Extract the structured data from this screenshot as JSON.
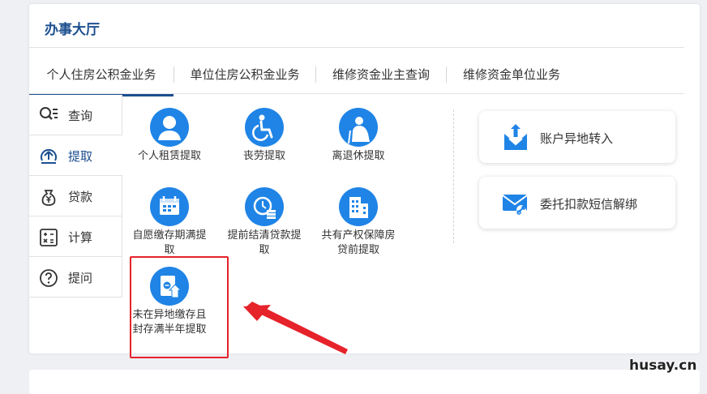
{
  "hall": {
    "title": "办事大厅"
  },
  "tabs": [
    {
      "label": "个人住房公积金业务",
      "active": true
    },
    {
      "label": "单位住房公积金业务",
      "active": false
    },
    {
      "label": "维修资金业主查询",
      "active": false
    },
    {
      "label": "维修资金单位业务",
      "active": false
    }
  ],
  "sidebar": {
    "items": [
      {
        "label": "查询",
        "icon": "search-list-icon"
      },
      {
        "label": "提取",
        "icon": "withdraw-icon",
        "active": true
      },
      {
        "label": "贷款",
        "icon": "yen-bag-icon"
      },
      {
        "label": "计算",
        "icon": "calculator-icon"
      },
      {
        "label": "提问",
        "icon": "question-icon"
      }
    ]
  },
  "services": [
    {
      "label": "个人租赁提取",
      "icon": "person-icon"
    },
    {
      "label": "丧劳提取",
      "icon": "wheelchair-icon"
    },
    {
      "label": "离退休提取",
      "icon": "retiree-icon"
    },
    {
      "label": "自愿缴存期满提取",
      "icon": "calendar-icon"
    },
    {
      "label": "提前结清贷款提取",
      "icon": "clock-coins-icon"
    },
    {
      "label": "共有产权保障房贷前提取",
      "icon": "building-icon"
    },
    {
      "label": "未在异地缴存且封存满半年提取",
      "icon": "document-upload-icon",
      "highlighted": true
    }
  ],
  "quick_actions": [
    {
      "label": "账户异地转入",
      "icon": "transfer-in-icon"
    },
    {
      "label": "委托扣款短信解绑",
      "icon": "sms-unbind-icon"
    }
  ],
  "colors": {
    "primary": "#1c4f8f",
    "icon_blue": "#1f84e6",
    "highlight": "#e6222a"
  },
  "watermark": "husay.cn"
}
